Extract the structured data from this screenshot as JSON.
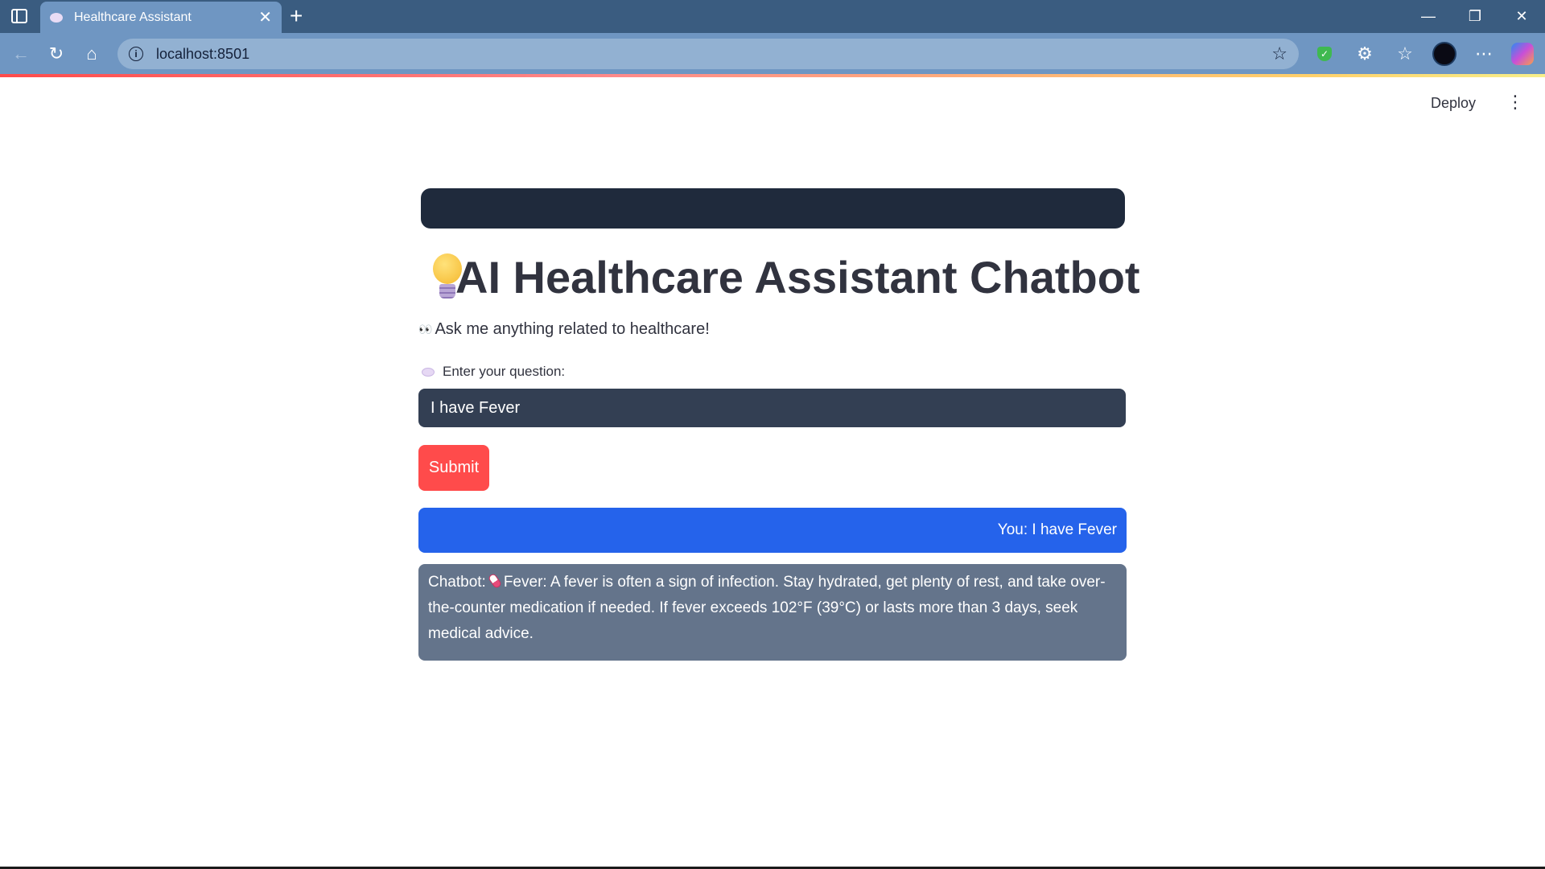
{
  "browser": {
    "tab_title": "Healthcare Assistant",
    "url": "localhost:8501"
  },
  "app_header": {
    "deploy_label": "Deploy"
  },
  "main": {
    "title": "AI Healthcare Assistant Chatbot",
    "subtitle": "Ask me anything related to healthcare!",
    "question_label": "Enter your question:",
    "question_value": "I have Fever",
    "submit_label": "Submit"
  },
  "chat": {
    "user_message": "You: I have Fever",
    "bot_prefix": "Chatbot:",
    "bot_message": "Fever: A fever is often a sign of infection. Stay hydrated, get plenty of rest, and take over-the-counter medication if needed. If fever exceeds 102°F (39°C) or lasts more than 3 days, seek medical advice."
  },
  "colors": {
    "accent_red": "#ff4b4b",
    "user_bubble": "#2563eb",
    "bot_bubble": "#64748b",
    "input_bg": "#333f53",
    "banner_bg": "#1f2a3c",
    "chrome_tabbar": "#3a5c80",
    "chrome_toolbar": "#6f96c2"
  },
  "icons": {
    "title_icon": "lightbulb-icon",
    "subtitle_icon": "eyes-icon",
    "label_icon": "speech-bubble-icon",
    "bot_icon": "thermometer-icon"
  }
}
